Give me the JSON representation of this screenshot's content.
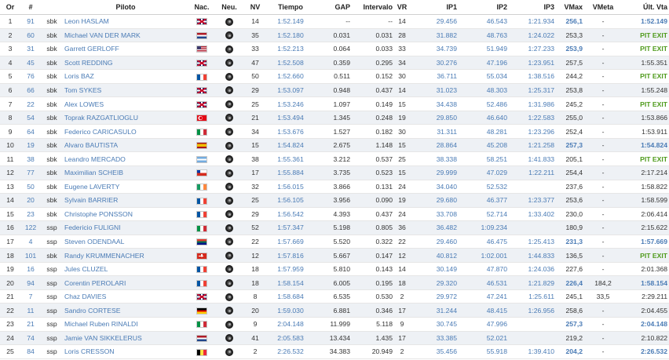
{
  "columns": [
    "Or",
    "#",
    "",
    "Piloto",
    "Nac.",
    "Neu.",
    "NV",
    "Tiempo",
    "GAP",
    "Intervalo",
    "VR",
    "IP1",
    "IP2",
    "IP3",
    "VMax",
    "VMeta",
    "Últ. Vta"
  ],
  "colors": {
    "link_blue": "#4a7bb5",
    "best_green": "#4e9a1b",
    "alt_row": "#eef1f5"
  },
  "rows": [
    {
      "pos": "1",
      "num": "91",
      "cls": "sbk",
      "rider": "Leon HASLAM",
      "nat": "GBR",
      "tyre": "tyre-icon",
      "laps": "14",
      "time": "1:52.149",
      "gap": "--",
      "interval": "--",
      "vr": "14",
      "ip1": "29.456",
      "ip2": "46.543",
      "ip3": "1:21.934",
      "vmax": "256,1",
      "vmeta": "-",
      "last": "1:52.149",
      "last_style": "best"
    },
    {
      "pos": "2",
      "num": "60",
      "cls": "sbk",
      "rider": "Michael VAN DER MARK",
      "nat": "NED",
      "tyre": "tyre-icon",
      "laps": "35",
      "time": "1:52.180",
      "gap": "0.031",
      "interval": "0.031",
      "vr": "28",
      "ip1": "31.882",
      "ip2": "48.763",
      "ip3": "1:24.022",
      "vmax": "253,3",
      "vmeta": "-",
      "last": "PIT EXIT",
      "last_style": "pit"
    },
    {
      "pos": "3",
      "num": "31",
      "cls": "sbk",
      "rider": "Garrett GERLOFF",
      "nat": "USA",
      "tyre": "tyre-icon",
      "laps": "33",
      "time": "1:52.213",
      "gap": "0.064",
      "interval": "0.033",
      "vr": "33",
      "ip1": "34.739",
      "ip2": "51.949",
      "ip3": "1:27.233",
      "vmax": "253,9",
      "vmeta": "-",
      "last": "PIT EXIT",
      "last_style": "pit"
    },
    {
      "pos": "4",
      "num": "45",
      "cls": "sbk",
      "rider": "Scott REDDING",
      "nat": "GBR",
      "tyre": "tyre-icon",
      "laps": "47",
      "time": "1:52.508",
      "gap": "0.359",
      "interval": "0.295",
      "vr": "34",
      "ip1": "30.276",
      "ip2": "47.196",
      "ip3": "1:23.951",
      "vmax": "257,5",
      "vmeta": "-",
      "last": "1:55.351",
      "last_style": "normal"
    },
    {
      "pos": "5",
      "num": "76",
      "cls": "sbk",
      "rider": "Loris BAZ",
      "nat": "FRA",
      "tyre": "tyre-icon",
      "laps": "50",
      "time": "1:52.660",
      "gap": "0.511",
      "interval": "0.152",
      "vr": "30",
      "ip1": "36.711",
      "ip2": "55.034",
      "ip3": "1:38.516",
      "vmax": "244,2",
      "vmeta": "-",
      "last": "PIT EXIT",
      "last_style": "pit"
    },
    {
      "pos": "6",
      "num": "66",
      "cls": "sbk",
      "rider": "Tom SYKES",
      "nat": "GBR",
      "tyre": "tyre-icon",
      "laps": "29",
      "time": "1:53.097",
      "gap": "0.948",
      "interval": "0.437",
      "vr": "14",
      "ip1": "31.023",
      "ip2": "48.303",
      "ip3": "1:25.317",
      "vmax": "253,8",
      "vmeta": "-",
      "last": "1:55.248",
      "last_style": "normal"
    },
    {
      "pos": "7",
      "num": "22",
      "cls": "sbk",
      "rider": "Alex LOWES",
      "nat": "GBR",
      "tyre": "tyre-icon",
      "laps": "25",
      "time": "1:53.246",
      "gap": "1.097",
      "interval": "0.149",
      "vr": "15",
      "ip1": "34.438",
      "ip2": "52.486",
      "ip3": "1:31.986",
      "vmax": "245,2",
      "vmeta": "-",
      "last": "PIT EXIT",
      "last_style": "pit"
    },
    {
      "pos": "8",
      "num": "54",
      "cls": "sbk",
      "rider": "Toprak RAZGATLIOGLU",
      "nat": "TUR",
      "tyre": "tyre-icon",
      "laps": "21",
      "time": "1:53.494",
      "gap": "1.345",
      "interval": "0.248",
      "vr": "19",
      "ip1": "29.850",
      "ip2": "46.640",
      "ip3": "1:22.583",
      "vmax": "255,0",
      "vmeta": "-",
      "last": "1:53.866",
      "last_style": "normal"
    },
    {
      "pos": "9",
      "num": "64",
      "cls": "sbk",
      "rider": "Federico CARICASULO",
      "nat": "ITA",
      "tyre": "tyre-icon",
      "laps": "34",
      "time": "1:53.676",
      "gap": "1.527",
      "interval": "0.182",
      "vr": "30",
      "ip1": "31.311",
      "ip2": "48.281",
      "ip3": "1:23.296",
      "vmax": "252,4",
      "vmeta": "-",
      "last": "1:53.911",
      "last_style": "normal"
    },
    {
      "pos": "10",
      "num": "19",
      "cls": "sbk",
      "rider": "Alvaro BAUTISTA",
      "nat": "ESP",
      "tyre": "tyre-icon",
      "laps": "15",
      "time": "1:54.824",
      "gap": "2.675",
      "interval": "1.148",
      "vr": "15",
      "ip1": "28.864",
      "ip2": "45.208",
      "ip3": "1:21.258",
      "vmax": "257,3",
      "vmeta": "-",
      "last": "1:54.824",
      "last_style": "best"
    },
    {
      "pos": "11",
      "num": "38",
      "cls": "sbk",
      "rider": "Leandro MERCADO",
      "nat": "ARG",
      "tyre": "tyre-icon",
      "laps": "38",
      "time": "1:55.361",
      "gap": "3.212",
      "interval": "0.537",
      "vr": "25",
      "ip1": "38.338",
      "ip2": "58.251",
      "ip3": "1:41.833",
      "vmax": "205,1",
      "vmeta": "-",
      "last": "PIT EXIT",
      "last_style": "pit"
    },
    {
      "pos": "12",
      "num": "77",
      "cls": "sbk",
      "rider": "Maximilian SCHEIB",
      "nat": "CHI",
      "tyre": "tyre-icon",
      "laps": "17",
      "time": "1:55.884",
      "gap": "3.735",
      "interval": "0.523",
      "vr": "15",
      "ip1": "29.999",
      "ip2": "47.029",
      "ip3": "1:22.211",
      "vmax": "254,4",
      "vmeta": "-",
      "last": "2:17.214",
      "last_style": "normal"
    },
    {
      "pos": "13",
      "num": "50",
      "cls": "sbk",
      "rider": "Eugene LAVERTY",
      "nat": "IRL",
      "tyre": "tyre-icon",
      "laps": "32",
      "time": "1:56.015",
      "gap": "3.866",
      "interval": "0.131",
      "vr": "24",
      "ip1": "34.040",
      "ip2": "52.532",
      "ip3": "",
      "vmax": "237,6",
      "vmeta": "-",
      "last": "1:58.822",
      "last_style": "normal"
    },
    {
      "pos": "14",
      "num": "20",
      "cls": "sbk",
      "rider": "Sylvain BARRIER",
      "nat": "FRA",
      "tyre": "tyre-icon",
      "laps": "25",
      "time": "1:56.105",
      "gap": "3.956",
      "interval": "0.090",
      "vr": "19",
      "ip1": "29.680",
      "ip2": "46.377",
      "ip3": "1:23.377",
      "vmax": "253,6",
      "vmeta": "-",
      "last": "1:58.599",
      "last_style": "normal"
    },
    {
      "pos": "15",
      "num": "23",
      "cls": "sbk",
      "rider": "Christophe PONSSON",
      "nat": "FRA",
      "tyre": "tyre-icon",
      "laps": "29",
      "time": "1:56.542",
      "gap": "4.393",
      "interval": "0.437",
      "vr": "24",
      "ip1": "33.708",
      "ip2": "52.714",
      "ip3": "1:33.402",
      "vmax": "230,0",
      "vmeta": "-",
      "last": "2:06.414",
      "last_style": "normal"
    },
    {
      "pos": "16",
      "num": "122",
      "cls": "ssp",
      "rider": "Federicio FULIGNI",
      "nat": "ITA",
      "tyre": "tyre-icon",
      "laps": "52",
      "time": "1:57.347",
      "gap": "5.198",
      "interval": "0.805",
      "vr": "36",
      "ip1": "36.482",
      "ip2": "1:09.234",
      "ip3": "",
      "vmax": "180,9",
      "vmeta": "-",
      "last": "2:15.622",
      "last_style": "normal"
    },
    {
      "pos": "17",
      "num": "4",
      "cls": "ssp",
      "rider": "Steven ODENDAAL",
      "nat": "RSA",
      "tyre": "tyre-icon",
      "laps": "22",
      "time": "1:57.669",
      "gap": "5.520",
      "interval": "0.322",
      "vr": "22",
      "ip1": "29.460",
      "ip2": "46.475",
      "ip3": "1:25.413",
      "vmax": "231,3",
      "vmeta": "-",
      "last": "1:57.669",
      "last_style": "best"
    },
    {
      "pos": "18",
      "num": "101",
      "cls": "sbk",
      "rider": "Randy KRUMMENACHER",
      "nat": "SUI",
      "tyre": "tyre-icon",
      "laps": "12",
      "time": "1:57.816",
      "gap": "5.667",
      "interval": "0.147",
      "vr": "12",
      "ip1": "40.812",
      "ip2": "1:02.001",
      "ip3": "1:44.833",
      "vmax": "136,5",
      "vmeta": "-",
      "last": "PIT EXIT",
      "last_style": "pit"
    },
    {
      "pos": "19",
      "num": "16",
      "cls": "ssp",
      "rider": "Jules CLUZEL",
      "nat": "FRA",
      "tyre": "tyre-icon",
      "laps": "18",
      "time": "1:57.959",
      "gap": "5.810",
      "interval": "0.143",
      "vr": "14",
      "ip1": "30.149",
      "ip2": "47.870",
      "ip3": "1:24.036",
      "vmax": "227,6",
      "vmeta": "-",
      "last": "2:01.368",
      "last_style": "normal"
    },
    {
      "pos": "20",
      "num": "94",
      "cls": "ssp",
      "rider": "Corentin PEROLARI",
      "nat": "FRA",
      "tyre": "tyre-icon",
      "laps": "18",
      "time": "1:58.154",
      "gap": "6.005",
      "interval": "0.195",
      "vr": "18",
      "ip1": "29.320",
      "ip2": "46.531",
      "ip3": "1:21.829",
      "vmax": "226,4",
      "vmeta": "184,2",
      "last": "1:58.154",
      "last_style": "best"
    },
    {
      "pos": "21",
      "num": "7",
      "cls": "ssp",
      "rider": "Chaz DAVIES",
      "nat": "GBR",
      "tyre": "tyre-icon",
      "laps": "8",
      "time": "1:58.684",
      "gap": "6.535",
      "interval": "0.530",
      "vr": "2",
      "ip1": "29.972",
      "ip2": "47.241",
      "ip3": "1:25.611",
      "vmax": "245,1",
      "vmeta": "33,5",
      "last": "2:29.211",
      "last_style": "normal"
    },
    {
      "pos": "22",
      "num": "11",
      "cls": "ssp",
      "rider": "Sandro CORTESE",
      "nat": "GER",
      "tyre": "tyre-icon",
      "laps": "20",
      "time": "1:59.030",
      "gap": "6.881",
      "interval": "0.346",
      "vr": "17",
      "ip1": "31.244",
      "ip2": "48.415",
      "ip3": "1:26.956",
      "vmax": "258,6",
      "vmeta": "-",
      "last": "2:04.455",
      "last_style": "normal"
    },
    {
      "pos": "23",
      "num": "21",
      "cls": "ssp",
      "rider": "Michael Ruben RINALDI",
      "nat": "ITA",
      "tyre": "tyre-icon",
      "laps": "9",
      "time": "2:04.148",
      "gap": "11.999",
      "interval": "5.118",
      "vr": "9",
      "ip1": "30.745",
      "ip2": "47.996",
      "ip3": "",
      "vmax": "257,3",
      "vmeta": "-",
      "last": "2:04.148",
      "last_style": "best"
    },
    {
      "pos": "24",
      "num": "74",
      "cls": "ssp",
      "rider": "Jamie VAN SIKKELERUS",
      "nat": "NED",
      "tyre": "tyre-icon",
      "laps": "41",
      "time": "2:05.583",
      "gap": "13.434",
      "interval": "1.435",
      "vr": "17",
      "ip1": "33.385",
      "ip2": "52.021",
      "ip3": "",
      "vmax": "219,2",
      "vmeta": "-",
      "last": "2:10.822",
      "last_style": "normal"
    },
    {
      "pos": "25",
      "num": "84",
      "cls": "ssp",
      "rider": "Loris CRESSON",
      "nat": "BEL",
      "tyre": "tyre-icon",
      "laps": "2",
      "time": "2:26.532",
      "gap": "34.383",
      "interval": "20.949",
      "vr": "2",
      "ip1": "35.456",
      "ip2": "55.918",
      "ip3": "1:39.410",
      "vmax": "204,2",
      "vmeta": "-",
      "last": "2:26.532",
      "last_style": "best"
    }
  ]
}
